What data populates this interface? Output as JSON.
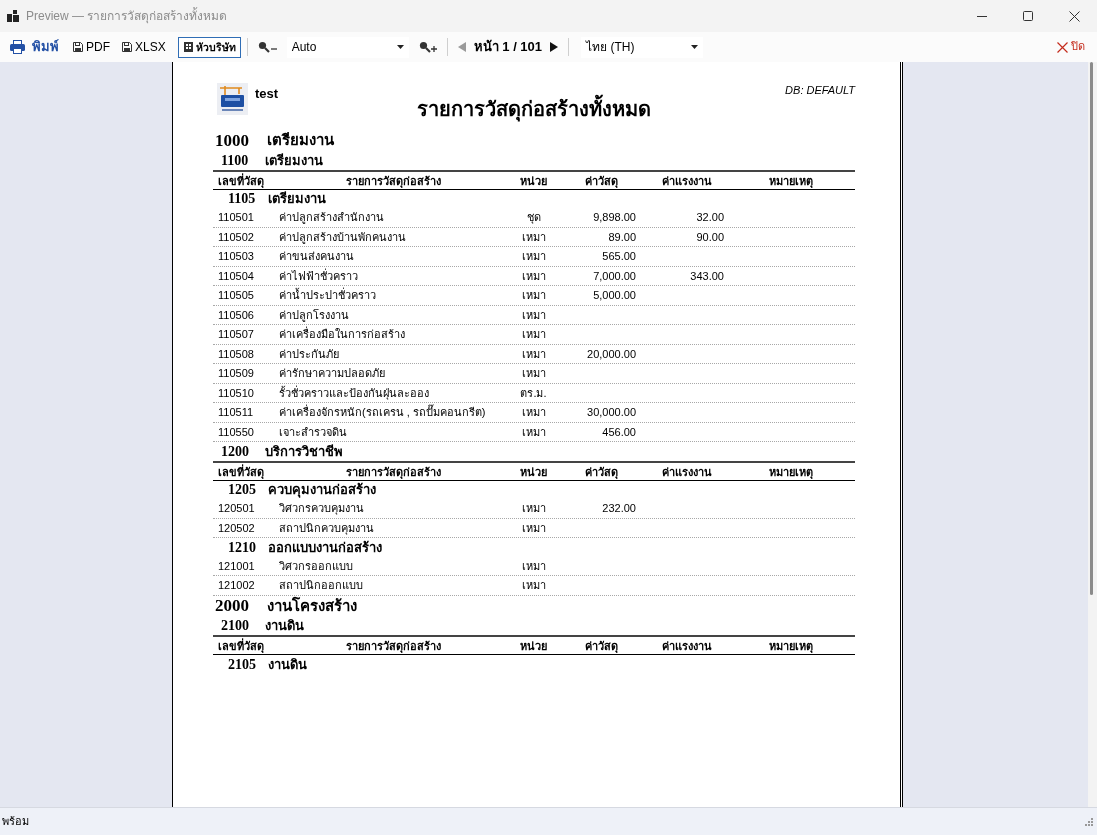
{
  "window": {
    "title": "Preview — รายการวัสดุก่อสร้างทั้งหมด"
  },
  "toolbar": {
    "print": {
      "label": "พิมพ์"
    },
    "exports": [
      {
        "label": "PDF"
      },
      {
        "label": "XLSX"
      }
    ],
    "company_header": {
      "label": "หัวบริษัท",
      "checked": true
    },
    "zoom": {
      "value": "Auto"
    },
    "pager": {
      "label": "หน้า 1 / 101",
      "prev": {
        "disabled": true
      },
      "next": {
        "disabled": false
      }
    },
    "language": {
      "value": "ไทย (TH)"
    },
    "close": {
      "label": "ปิด"
    }
  },
  "report": {
    "company": "test",
    "title": "รายการวัสดุก่อสร้างทั้งหมด",
    "database": "DB: DEFAULT",
    "groups": [
      {
        "code": "1000",
        "name": "เตรียมงาน",
        "children": [
          {
            "code": "1100",
            "name": "เตรียมงาน",
            "columns": [
              "เลขที่วัสดุ",
              "รายการวัสดุก่อสร้าง",
              "หน่วย",
              "ค่าวัสดุ",
              "ค่าแรงงาน",
              "หมายเหตุ"
            ],
            "children": [
              {
                "code": "1105",
                "name": "เตรียมงาน",
                "rows": [
                  {
                    "code": "110501",
                    "name": "ค่าปลูกสร้างสำนักงาน",
                    "unit": "ชุด",
                    "material_cost": "9,898.00",
                    "labor_cost": "32.00"
                  },
                  {
                    "code": "110502",
                    "name": "ค่าปลูกสร้างบ้านพักคนงาน",
                    "unit": "เหมา",
                    "material_cost": "89.00",
                    "labor_cost": "90.00"
                  },
                  {
                    "code": "110503",
                    "name": "ค่าขนส่งคนงาน",
                    "unit": "เหมา",
                    "material_cost": "565.00"
                  },
                  {
                    "code": "110504",
                    "name": "ค่าไฟฟ้าชั่วคราว",
                    "unit": "เหมา",
                    "material_cost": "7,000.00",
                    "labor_cost": "343.00"
                  },
                  {
                    "code": "110505",
                    "name": "ค่าน้ำประปาชั่วคราว",
                    "unit": "เหมา",
                    "material_cost": "5,000.00"
                  },
                  {
                    "code": "110506",
                    "name": "ค่าปลูกโรงงาน",
                    "unit": "เหมา"
                  },
                  {
                    "code": "110507",
                    "name": "ค่าเครื่องมือในการก่อสร้าง",
                    "unit": "เหมา"
                  },
                  {
                    "code": "110508",
                    "name": "ค่าประกันภัย",
                    "unit": "เหมา",
                    "material_cost": "20,000.00"
                  },
                  {
                    "code": "110509",
                    "name": "ค่ารักษาความปลอดภัย",
                    "unit": "เหมา"
                  },
                  {
                    "code": "110510",
                    "name": "รั้วชั่วคราวและป้องกันฝุ่นละออง",
                    "unit": "ตร.ม."
                  },
                  {
                    "code": "110511",
                    "name": "ค่าเครื่องจักรหนัก(รถเครน , รถปั๊มคอนกรีต)",
                    "unit": "เหมา",
                    "material_cost": "30,000.00"
                  },
                  {
                    "code": "110550",
                    "name": "เจาะสำรวจดิน",
                    "unit": "เหมา",
                    "material_cost": "456.00"
                  }
                ]
              }
            ]
          },
          {
            "code": "1200",
            "name": "บริการวิชาชีพ",
            "columns": [
              "เลขที่วัสดุ",
              "รายการวัสดุก่อสร้าง",
              "หน่วย",
              "ค่าวัสดุ",
              "ค่าแรงงาน",
              "หมายเหตุ"
            ],
            "children": [
              {
                "code": "1205",
                "name": "ควบคุมงานก่อสร้าง",
                "rows": [
                  {
                    "code": "120501",
                    "name": "วิศวกรควบคุมงาน",
                    "unit": "เหมา",
                    "material_cost": "232.00"
                  },
                  {
                    "code": "120502",
                    "name": "สถาปนิกควบคุมงาน",
                    "unit": "เหมา"
                  }
                ]
              },
              {
                "code": "1210",
                "name": "ออกแบบงานก่อสร้าง",
                "rows": [
                  {
                    "code": "121001",
                    "name": "วิศวกรออกแบบ",
                    "unit": "เหมา"
                  },
                  {
                    "code": "121002",
                    "name": "สถาปนิกออกแบบ",
                    "unit": "เหมา"
                  }
                ]
              }
            ]
          }
        ]
      },
      {
        "code": "2000",
        "name": "งานโครงสร้าง",
        "children": [
          {
            "code": "2100",
            "name": "งานดิน",
            "columns": [
              "เลขที่วัสดุ",
              "รายการวัสดุก่อสร้าง",
              "หน่วย",
              "ค่าวัสดุ",
              "ค่าแรงงาน",
              "หมายเหตุ"
            ],
            "children": [
              {
                "code": "2105",
                "name": "งานดิน"
              }
            ]
          }
        ]
      }
    ]
  },
  "status_bar": {
    "text": "พร้อม"
  }
}
